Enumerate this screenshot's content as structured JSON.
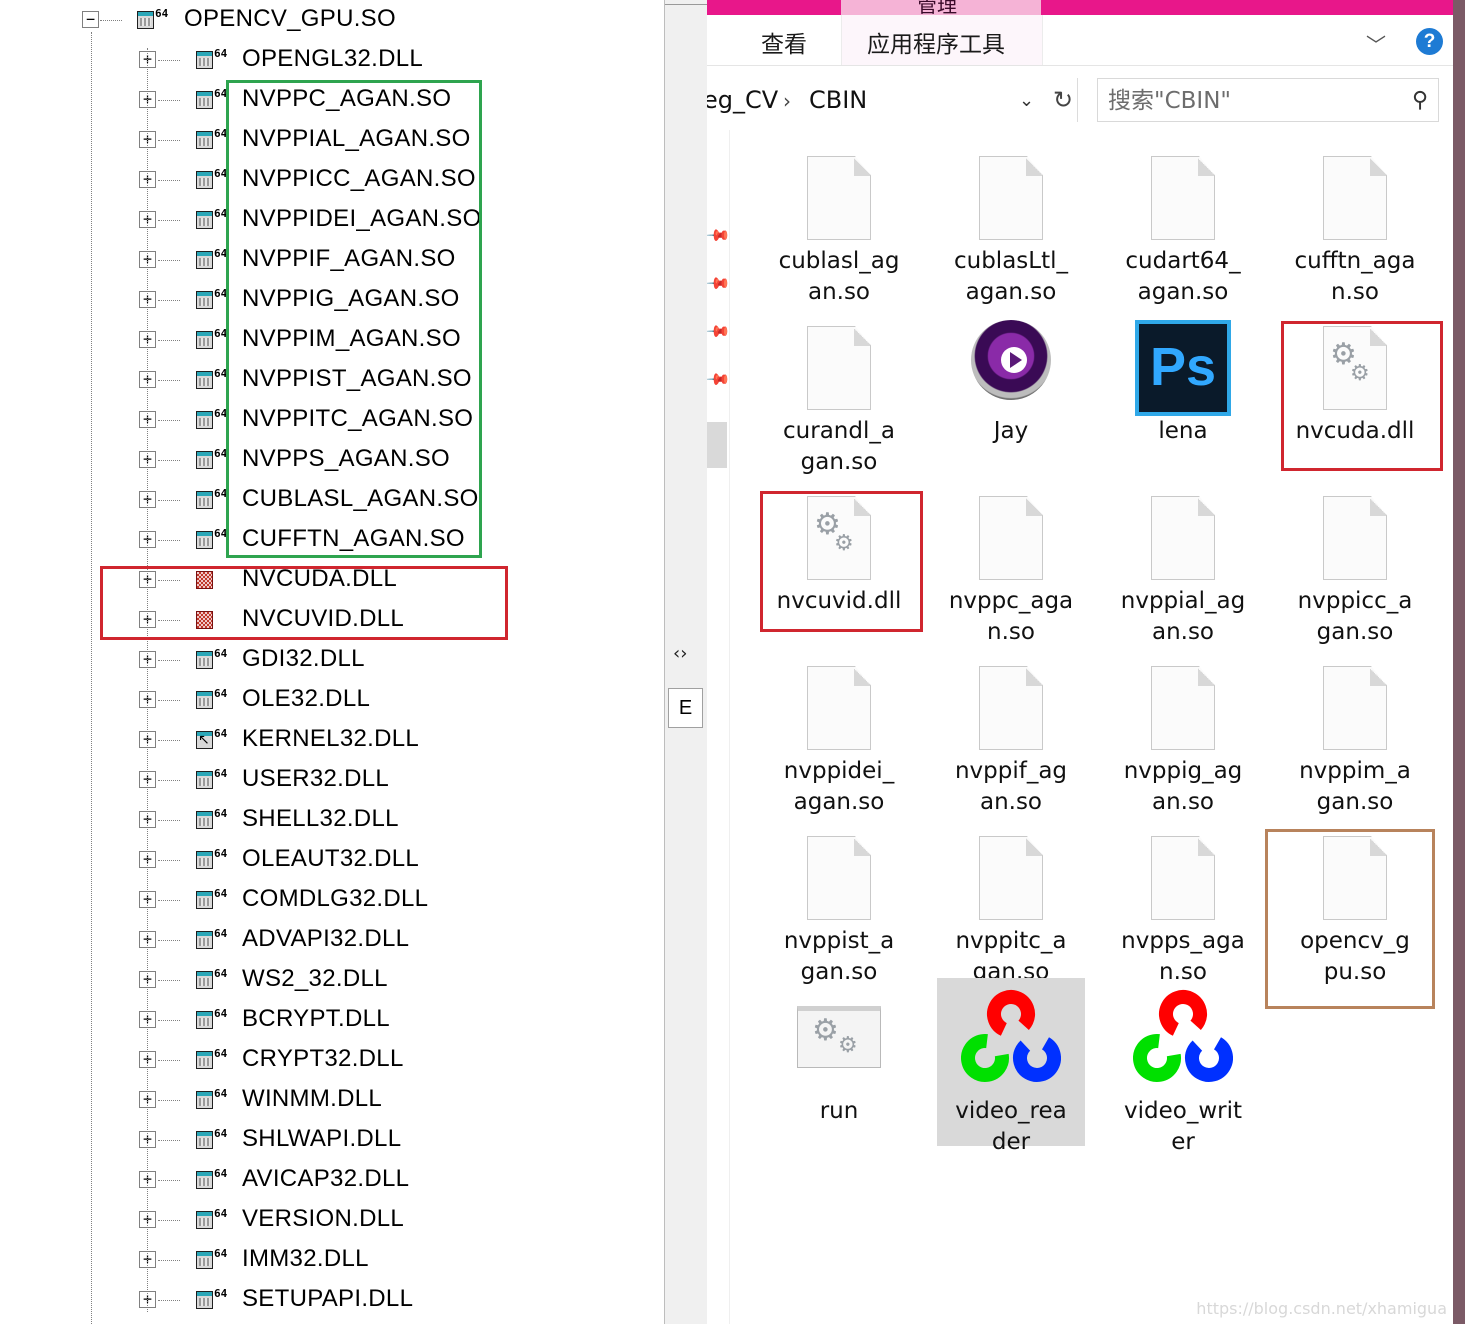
{
  "tree": {
    "root": {
      "expander": "−",
      "name": "OPENCV_GPU.SO"
    },
    "children": [
      {
        "expander": "+",
        "name": "OPENGL32.DLL",
        "icon": "module-64bit-icon"
      },
      {
        "expander": "+",
        "name": "NVPPC_AGAN.SO",
        "icon": "module-64bit-icon"
      },
      {
        "expander": "+",
        "name": "NVPPIAL_AGAN.SO",
        "icon": "module-64bit-icon"
      },
      {
        "expander": "+",
        "name": "NVPPICC_AGAN.SO",
        "icon": "module-64bit-icon"
      },
      {
        "expander": "+",
        "name": "NVPPIDEI_AGAN.SO",
        "icon": "module-64bit-icon"
      },
      {
        "expander": "+",
        "name": "NVPPIF_AGAN.SO",
        "icon": "module-64bit-icon"
      },
      {
        "expander": "+",
        "name": "NVPPIG_AGAN.SO",
        "icon": "module-64bit-icon"
      },
      {
        "expander": "+",
        "name": "NVPPIM_AGAN.SO",
        "icon": "module-64bit-icon"
      },
      {
        "expander": "+",
        "name": "NVPPIST_AGAN.SO",
        "icon": "module-64bit-icon"
      },
      {
        "expander": "+",
        "name": "NVPPITC_AGAN.SO",
        "icon": "module-64bit-icon"
      },
      {
        "expander": "+",
        "name": "NVPPS_AGAN.SO",
        "icon": "module-64bit-icon"
      },
      {
        "expander": "+",
        "name": "CUBLASL_AGAN.SO",
        "icon": "module-64bit-icon"
      },
      {
        "expander": "+",
        "name": "CUFFTN_AGAN.SO",
        "icon": "module-64bit-icon"
      },
      {
        "expander": "+",
        "name": "NVCUDA.DLL",
        "icon": "missing-module-icon"
      },
      {
        "expander": "+",
        "name": "NVCUVID.DLL",
        "icon": "missing-module-icon"
      },
      {
        "expander": "+",
        "name": "GDI32.DLL",
        "icon": "module-64bit-icon"
      },
      {
        "expander": "+",
        "name": "OLE32.DLL",
        "icon": "module-64bit-icon"
      },
      {
        "expander": "+",
        "name": "KERNEL32.DLL",
        "icon": "module-forwarded-icon"
      },
      {
        "expander": "+",
        "name": "USER32.DLL",
        "icon": "module-64bit-icon"
      },
      {
        "expander": "+",
        "name": "SHELL32.DLL",
        "icon": "module-64bit-icon"
      },
      {
        "expander": "+",
        "name": "OLEAUT32.DLL",
        "icon": "module-64bit-icon"
      },
      {
        "expander": "+",
        "name": "COMDLG32.DLL",
        "icon": "module-64bit-icon"
      },
      {
        "expander": "+",
        "name": "ADVAPI32.DLL",
        "icon": "module-64bit-icon"
      },
      {
        "expander": "+",
        "name": "WS2_32.DLL",
        "icon": "module-64bit-icon"
      },
      {
        "expander": "+",
        "name": "BCRYPT.DLL",
        "icon": "module-64bit-icon"
      },
      {
        "expander": "+",
        "name": "CRYPT32.DLL",
        "icon": "module-64bit-icon"
      },
      {
        "expander": "+",
        "name": "WINMM.DLL",
        "icon": "module-64bit-icon"
      },
      {
        "expander": "+",
        "name": "SHLWAPI.DLL",
        "icon": "module-64bit-icon"
      },
      {
        "expander": "+",
        "name": "AVICAP32.DLL",
        "icon": "module-64bit-icon"
      },
      {
        "expander": "+",
        "name": "VERSION.DLL",
        "icon": "module-64bit-icon"
      },
      {
        "expander": "+",
        "name": "IMM32.DLL",
        "icon": "module-64bit-icon"
      },
      {
        "expander": "+",
        "name": "SETUPAPI.DLL",
        "icon": "module-64bit-icon"
      }
    ],
    "icon_bits_label": "64",
    "highlight_colors": {
      "green": "#2ea44f",
      "red": "#d0262f",
      "brown": "#b8835c"
    }
  },
  "splitter": {
    "arrows": "‹›",
    "e_button": "E"
  },
  "explorer": {
    "ribbon": {
      "tab_view": "查看",
      "tab_tools": "应用程序工具",
      "context_tab": "管理",
      "help": "?",
      "collapse_icon": "chevron-down-icon"
    },
    "address": {
      "crumb_prev": "eg_CV",
      "separator": "›",
      "crumb_current": "CBIN"
    },
    "search": {
      "placeholder": "搜索\"CBIN\""
    },
    "files": [
      {
        "name_line1": "cublasl_ag",
        "name_line2": "an.so",
        "icon": "file-icon"
      },
      {
        "name_line1": "cublasLtl_",
        "name_line2": "agan.so",
        "icon": "file-icon"
      },
      {
        "name_line1": "cudart64_",
        "name_line2": "agan.so",
        "icon": "file-icon"
      },
      {
        "name_line1": "cufftn_aga",
        "name_line2": "n.so",
        "icon": "file-icon"
      },
      {
        "name_line1": "curandl_a",
        "name_line2": "gan.so",
        "icon": "file-icon"
      },
      {
        "name_line1": "Jay",
        "name_line2": "",
        "icon": "media-player-icon"
      },
      {
        "name_line1": "lena",
        "name_line2": "",
        "icon": "photoshop-icon",
        "icon_text": "Ps"
      },
      {
        "name_line1": "nvcuda.dll",
        "name_line2": "",
        "icon": "dll-gear-icon"
      },
      {
        "name_line1": "nvcuvid.dll",
        "name_line2": "",
        "icon": "dll-gear-icon"
      },
      {
        "name_line1": "nvppc_aga",
        "name_line2": "n.so",
        "icon": "file-icon"
      },
      {
        "name_line1": "nvppial_ag",
        "name_line2": "an.so",
        "icon": "file-icon"
      },
      {
        "name_line1": "nvppicc_a",
        "name_line2": "gan.so",
        "icon": "file-icon"
      },
      {
        "name_line1": "nvppidei_",
        "name_line2": "agan.so",
        "icon": "file-icon"
      },
      {
        "name_line1": "nvppif_ag",
        "name_line2": "an.so",
        "icon": "file-icon"
      },
      {
        "name_line1": "nvppig_ag",
        "name_line2": "an.so",
        "icon": "file-icon"
      },
      {
        "name_line1": "nvppim_a",
        "name_line2": "gan.so",
        "icon": "file-icon"
      },
      {
        "name_line1": "nvppist_a",
        "name_line2": "gan.so",
        "icon": "file-icon"
      },
      {
        "name_line1": "nvppitc_a",
        "name_line2": "gan.so",
        "icon": "file-icon"
      },
      {
        "name_line1": "nvpps_aga",
        "name_line2": "n.so",
        "icon": "file-icon"
      },
      {
        "name_line1": "opencv_g",
        "name_line2": "pu.so",
        "icon": "file-icon"
      },
      {
        "name_line1": "run",
        "name_line2": "",
        "icon": "exe-gear-icon"
      },
      {
        "name_line1": "video_rea",
        "name_line2": "der",
        "icon": "opencv-logo-icon",
        "selected": true
      },
      {
        "name_line1": "video_writ",
        "name_line2": "er",
        "icon": "opencv-logo-icon"
      }
    ]
  },
  "watermark": "https://blog.csdn.net/xhamigua"
}
